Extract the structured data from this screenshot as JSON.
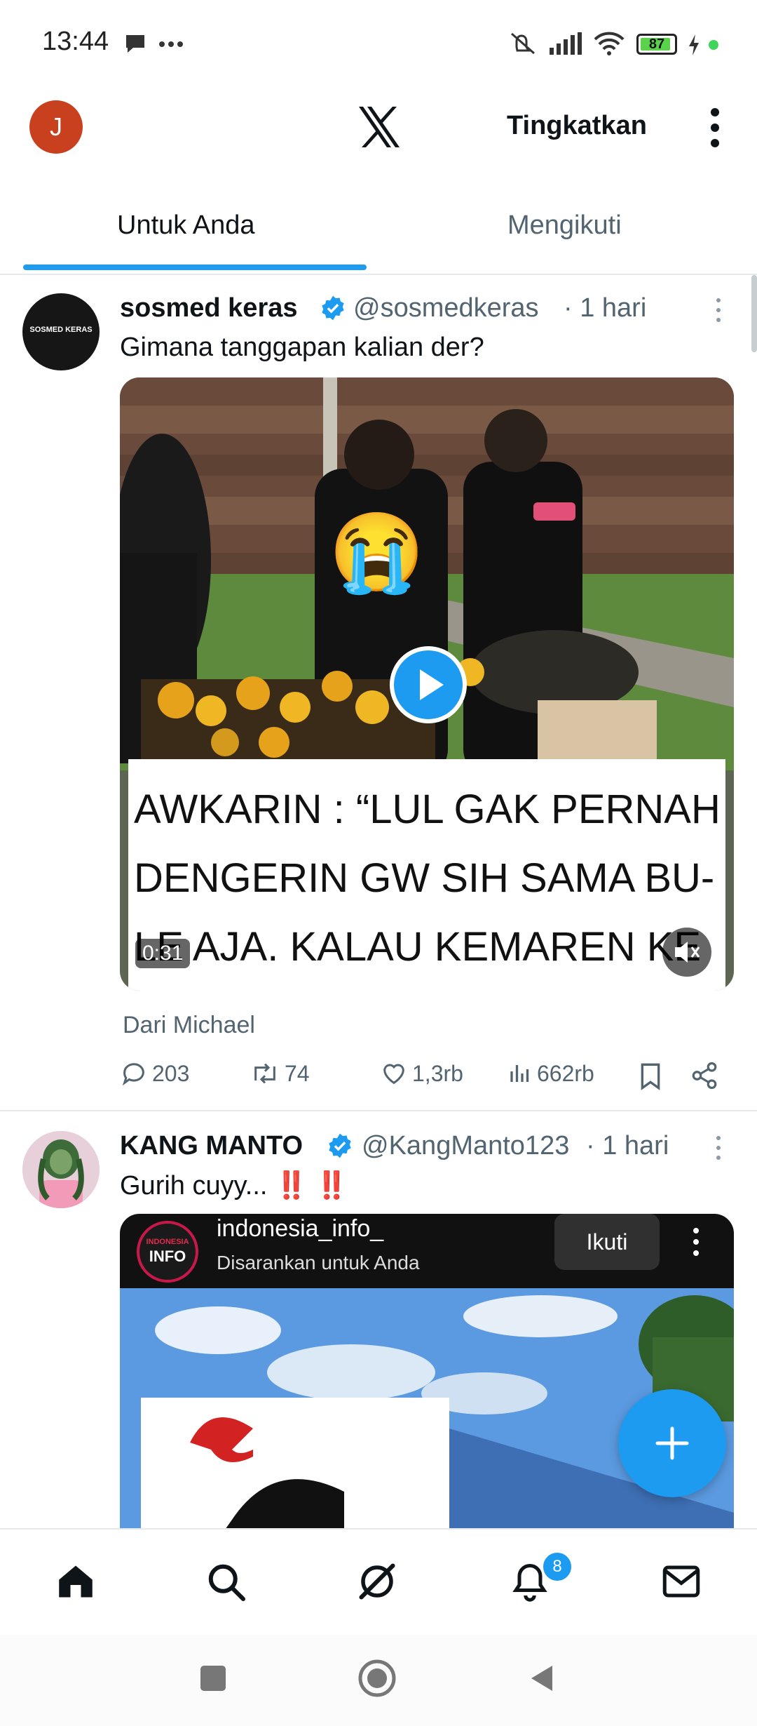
{
  "status_bar": {
    "time": "13:44",
    "battery": "87"
  },
  "header": {
    "avatar_letter": "J",
    "upgrade_label": "Tingkatkan"
  },
  "tabs": [
    {
      "label": "Untuk Anda"
    },
    {
      "label": "Mengikuti"
    }
  ],
  "colors": {
    "accent": "#1d9bf0",
    "avatar_bg": "#c8401e",
    "text": "#0f1419",
    "muted": "#536471"
  },
  "tweets": [
    {
      "avatar_text": "SOSMED KERAS",
      "name": "sosmed keras",
      "handle": "@sosmedkeras",
      "time": "· 1 hari",
      "text": "Gimana tanggapan kalian der?",
      "video": {
        "caption_lines": [
          "AWKARIN : “LUL  GAK PERNAH",
          "DENGERIN  GW SIH SAMA BU-",
          "LE AJA. KALAU  KEMAREN  KE"
        ],
        "duration": "0:31",
        "emoji": "😭"
      },
      "source": "Dari Michael",
      "actions": {
        "replies": "203",
        "retweets": "74",
        "likes": "1,3rb",
        "views": "662rb"
      }
    },
    {
      "name": "KANG MANTO",
      "handle": "@KangManto123",
      "time": "· 1 hari",
      "text": "Gurih cuyy... ‼️ ‼️",
      "embed": {
        "logo_lines": [
          "INDONESIA",
          "INFO"
        ],
        "account": "indonesia_info_",
        "subtitle": "Disarankan untuk Anda",
        "follow_label": "Ikuti"
      }
    }
  ],
  "nav": {
    "notifications_badge": "8"
  },
  "icons": [
    "chat-bubble-icon",
    "more-dots-icon",
    "mute-icon",
    "signal-icon",
    "wifi-icon",
    "battery-icon",
    "charging-icon",
    "x-logo-icon",
    "verified-icon",
    "play-icon",
    "reply-icon",
    "retweet-icon",
    "like-icon",
    "views-icon",
    "bookmark-icon",
    "share-icon",
    "plus-icon",
    "home-icon",
    "search-icon",
    "grok-icon",
    "bell-icon",
    "mail-icon"
  ]
}
